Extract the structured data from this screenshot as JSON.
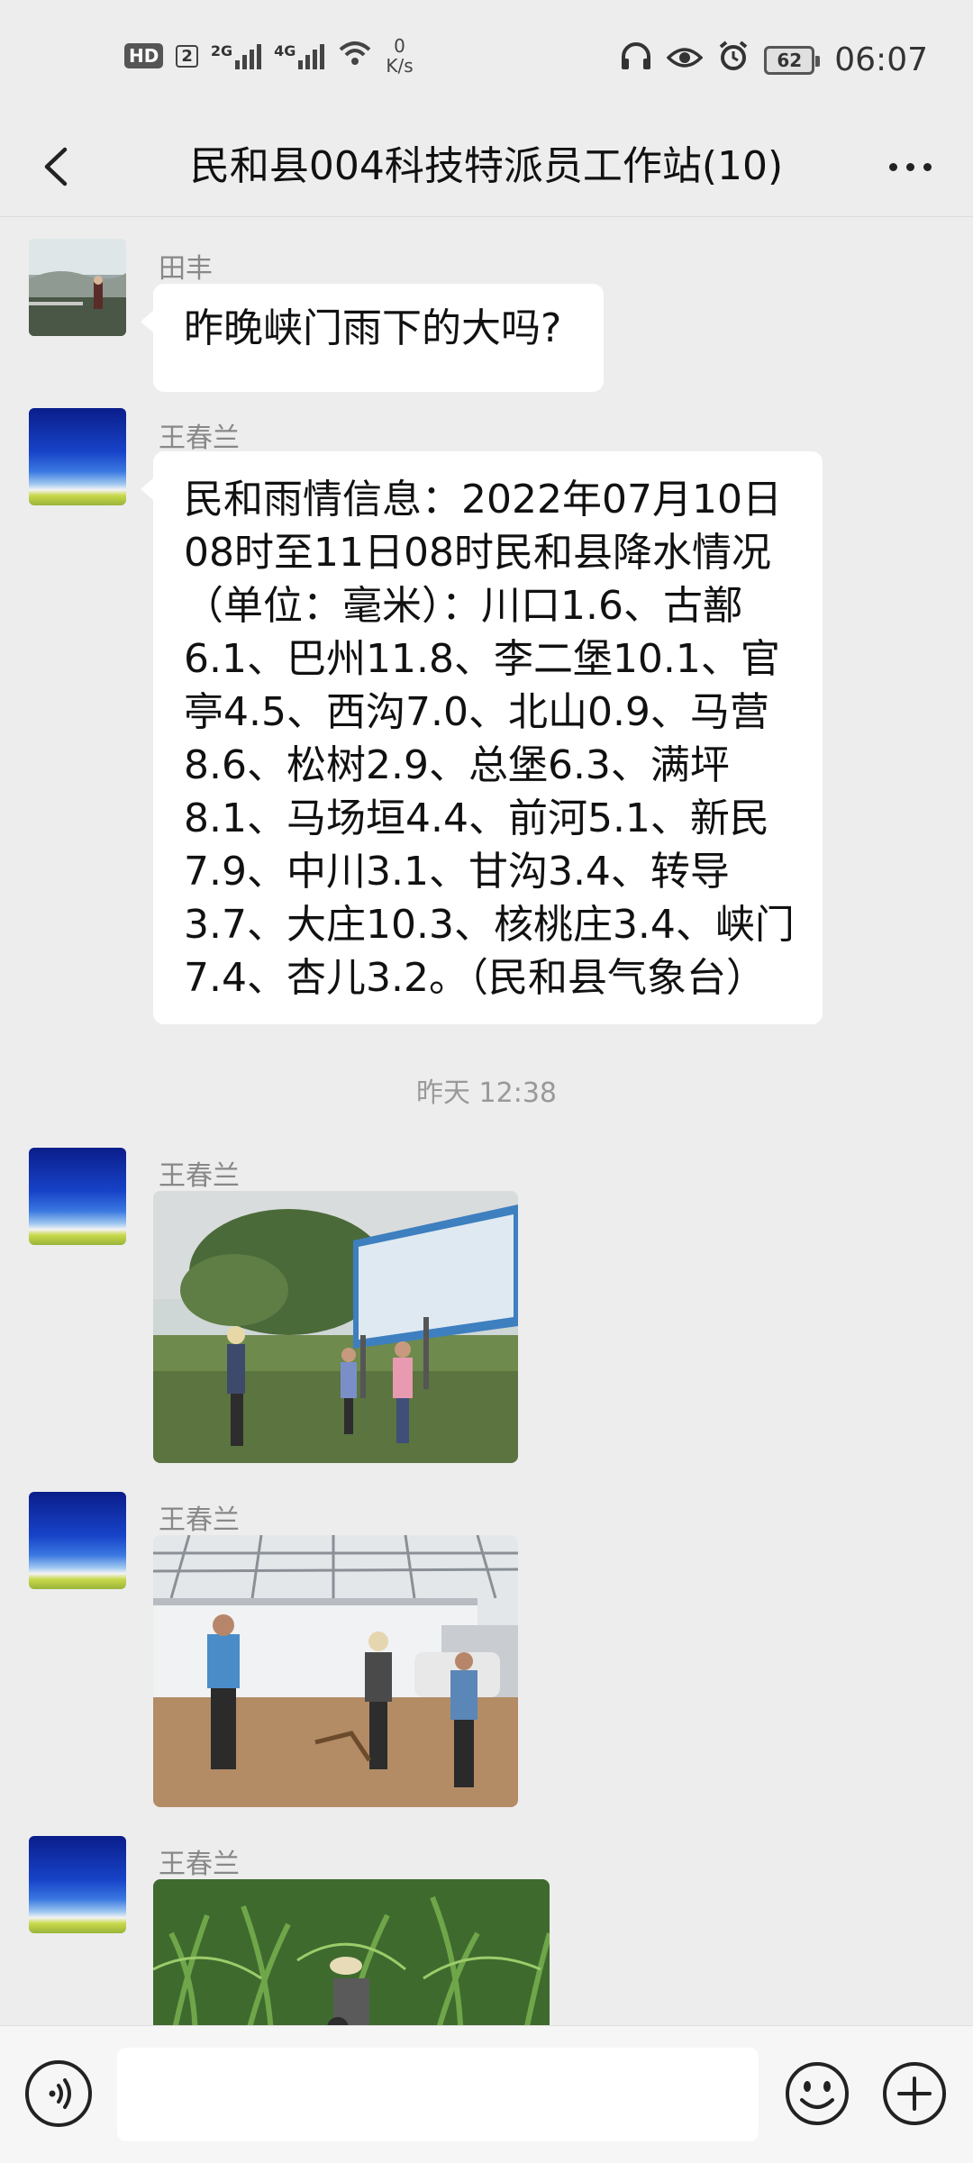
{
  "status_bar": {
    "hd_label": "HD",
    "sim_label": "2",
    "network_1": "2G",
    "network_2": "4G",
    "speed_value": "0",
    "speed_unit": "K/s",
    "battery": "62",
    "time": "06:07"
  },
  "header": {
    "title": "民和县004科技特派员工作站(10)"
  },
  "messages": [
    {
      "sender": "田丰",
      "text": "昨晚峡门雨下的大吗?"
    },
    {
      "sender": "王春兰",
      "text": "民和雨情信息：2022年07月10日08时至11日08时民和县降水情况（单位：毫米）：川口1.6、古鄯6.1、巴州11.8、李二堡10.1、官亭4.5、西沟7.0、北山0.9、马营8.6、松树2.9、总堡6.3、满坪8.1、马场垣4.4、前河5.1、新民7.9、中川3.1、甘沟3.4、转导3.7、大庄10.3、核桃庄3.4、峡门7.4、杏儿3.2。（民和县气象台）"
    },
    {
      "sender": "王春兰"
    },
    {
      "sender": "王春兰"
    },
    {
      "sender": "王春兰"
    }
  ],
  "timestamp": "昨天 12:38",
  "input": {
    "value": ""
  },
  "colors": {
    "background": "#ededed",
    "bubble": "#ffffff",
    "muted_text": "#888888"
  }
}
